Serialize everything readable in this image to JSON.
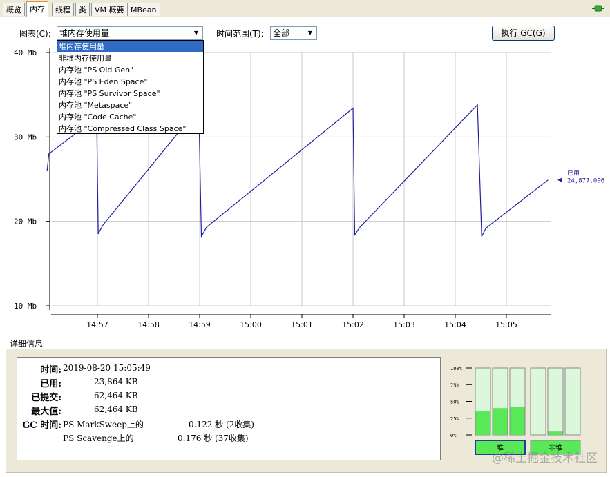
{
  "tabs": [
    "概览",
    "内存",
    "线程",
    "类",
    "VM 概要",
    "MBean"
  ],
  "active_tab": 1,
  "controls": {
    "chart_label": "图表(C):",
    "chart_value": "堆内存使用量",
    "time_label": "时间范围(T):",
    "time_value": "全部",
    "gc_button": "执行 GC(G)"
  },
  "dropdown_items": [
    "堆内存使用量",
    "非堆内存使用量",
    "内存池 \"PS Old Gen\"",
    "内存池 \"PS Eden Space\"",
    "内存池 \"PS Survivor Space\"",
    "内存池 \"Metaspace\"",
    "内存池 \"Code Cache\"",
    "内存池 \"Compressed Class Space\""
  ],
  "chart_data": {
    "type": "line",
    "title": "",
    "y_ticks": [
      "10 Mb",
      "20 Mb",
      "30 Mb",
      "40 Mb"
    ],
    "ylim": [
      10,
      40
    ],
    "x_ticks": [
      "14:57",
      "14:58",
      "14:59",
      "15:00",
      "15:01",
      "15:02",
      "15:03",
      "15:04",
      "15:05"
    ],
    "series": [
      {
        "name": "已用",
        "current_value": "24,877,096",
        "color": "#20209f",
        "points": [
          [
            "14:56:01",
            26.0
          ],
          [
            "14:56:03",
            28.0
          ],
          [
            "14:56:55",
            32.0
          ],
          [
            "14:56:59",
            33.0
          ],
          [
            "14:57:01",
            18.5
          ],
          [
            "14:57:06",
            19.5
          ],
          [
            "14:58:59",
            33.5
          ],
          [
            "14:59:02",
            18.2
          ],
          [
            "14:59:08",
            19.3
          ],
          [
            "15:02:00",
            33.4
          ],
          [
            "15:02:02",
            18.4
          ],
          [
            "15:02:08",
            19.3
          ],
          [
            "15:04:26",
            33.8
          ],
          [
            "15:04:31",
            18.2
          ],
          [
            "15:04:36",
            19.2
          ],
          [
            "15:05:49",
            24.9
          ]
        ]
      }
    ],
    "grid": true
  },
  "details": {
    "title": "详细信息",
    "rows": [
      {
        "label": "时间:",
        "value": "2019-08-20 15:05:49"
      },
      {
        "label": "已用:",
        "value": "23,864 KB"
      },
      {
        "label": "已提交:",
        "value": "62,464 KB"
      },
      {
        "label": "最大值:",
        "value": "62,464 KB"
      },
      {
        "label": "GC 时间:",
        "value": "PS MarkSweep上的",
        "extra": "0.122 秒 (2收集)"
      }
    ],
    "gc_row2": {
      "value": "PS Scavenge上的",
      "extra": "0.176 秒 (37收集)"
    }
  },
  "pool_bars": {
    "scale": [
      "100%",
      "75%",
      "50%",
      "25%",
      "0%"
    ],
    "heap_label": "堆",
    "nonheap_label": "非堆",
    "heap_fill": [
      0.35,
      0.4,
      0.42
    ],
    "nonheap_fill": [
      0.0,
      0.05,
      0.0
    ],
    "fill_color": "#58e858",
    "empty_color": "#dcf8dc"
  },
  "watermark": "@稀土掘金技术社区"
}
